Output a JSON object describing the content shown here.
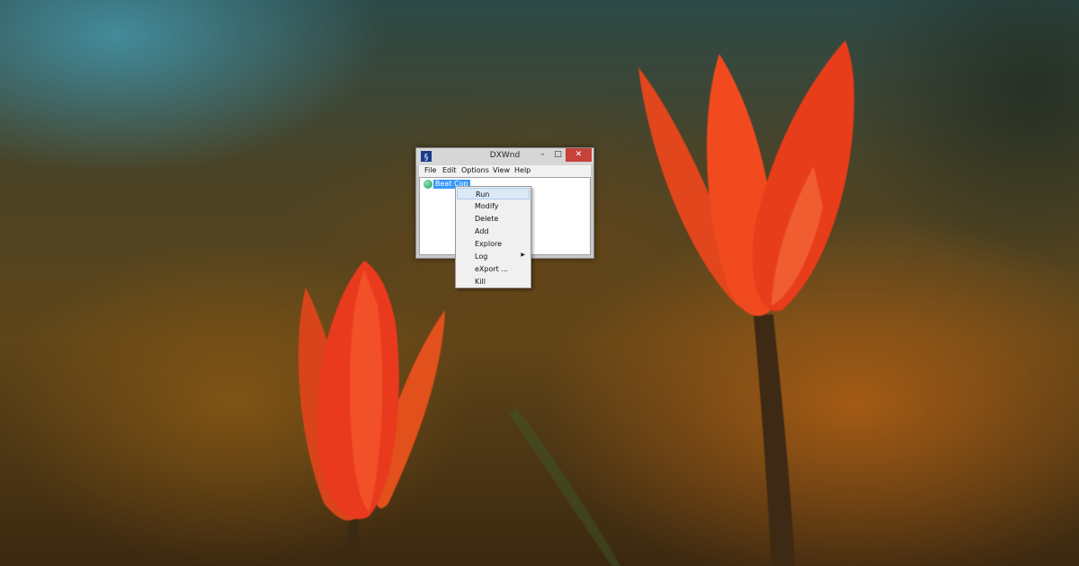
{
  "window": {
    "title": "DXWnd",
    "minimize_glyph": "–",
    "maximize_glyph": "□",
    "close_glyph": "✕"
  },
  "menubar": {
    "items": [
      "File",
      "Edit",
      "Options",
      "View",
      "Help"
    ]
  },
  "program_list": {
    "entries": [
      {
        "label": "Beat Cop",
        "icon": "green-status-icon",
        "selected": true
      }
    ]
  },
  "context_menu": {
    "items": [
      {
        "label": "Run",
        "highlighted": true,
        "submenu": false
      },
      {
        "label": "Modify",
        "highlighted": false,
        "submenu": false
      },
      {
        "label": "Delete",
        "highlighted": false,
        "submenu": false
      },
      {
        "label": "Add",
        "highlighted": false,
        "submenu": false
      },
      {
        "label": "Explore",
        "highlighted": false,
        "submenu": false
      },
      {
        "label": "Log",
        "highlighted": false,
        "submenu": true
      },
      {
        "label": "eXport ...",
        "highlighted": false,
        "submenu": false
      },
      {
        "label": "Kill",
        "highlighted": false,
        "submenu": false
      }
    ],
    "submenu_arrow_glyph": "▶"
  },
  "colors": {
    "selection": "#3399ff",
    "close_button": "#c7423a",
    "menu_highlight": "#dbe8f6"
  }
}
